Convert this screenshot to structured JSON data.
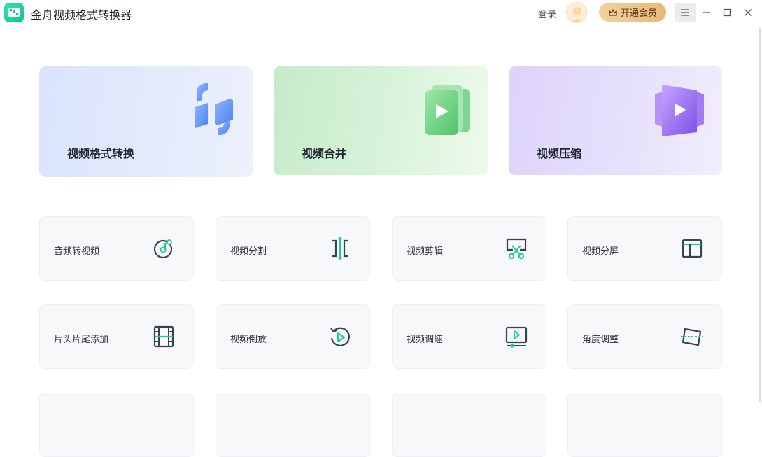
{
  "window": {
    "app_title": "金舟视频格式转换器",
    "login_label": "登录",
    "vip_label": "开通会员"
  },
  "feature_cards": [
    {
      "label": "视频格式转换",
      "icon": "format-convert-icon"
    },
    {
      "label": "视频合并",
      "icon": "video-merge-icon"
    },
    {
      "label": "视频压缩",
      "icon": "video-compress-icon"
    }
  ],
  "tools": [
    {
      "label": "音频转视频",
      "icon": "audio-to-video-icon"
    },
    {
      "label": "视频分割",
      "icon": "video-split-icon"
    },
    {
      "label": "视频剪辑",
      "icon": "scissors-icon"
    },
    {
      "label": "视频分屏",
      "icon": "split-screen-icon"
    },
    {
      "label": "片头片尾添加",
      "icon": "film-strip-icon"
    },
    {
      "label": "视频倒放",
      "icon": "reverse-play-icon"
    },
    {
      "label": "视频调速",
      "icon": "speed-adjust-icon"
    },
    {
      "label": "角度调整",
      "icon": "rotate-angle-icon"
    }
  ],
  "colors": {
    "accent_teal": "#1fc9a1",
    "icon_dark": "#3a4250",
    "vip_gold": "#e8b878"
  }
}
